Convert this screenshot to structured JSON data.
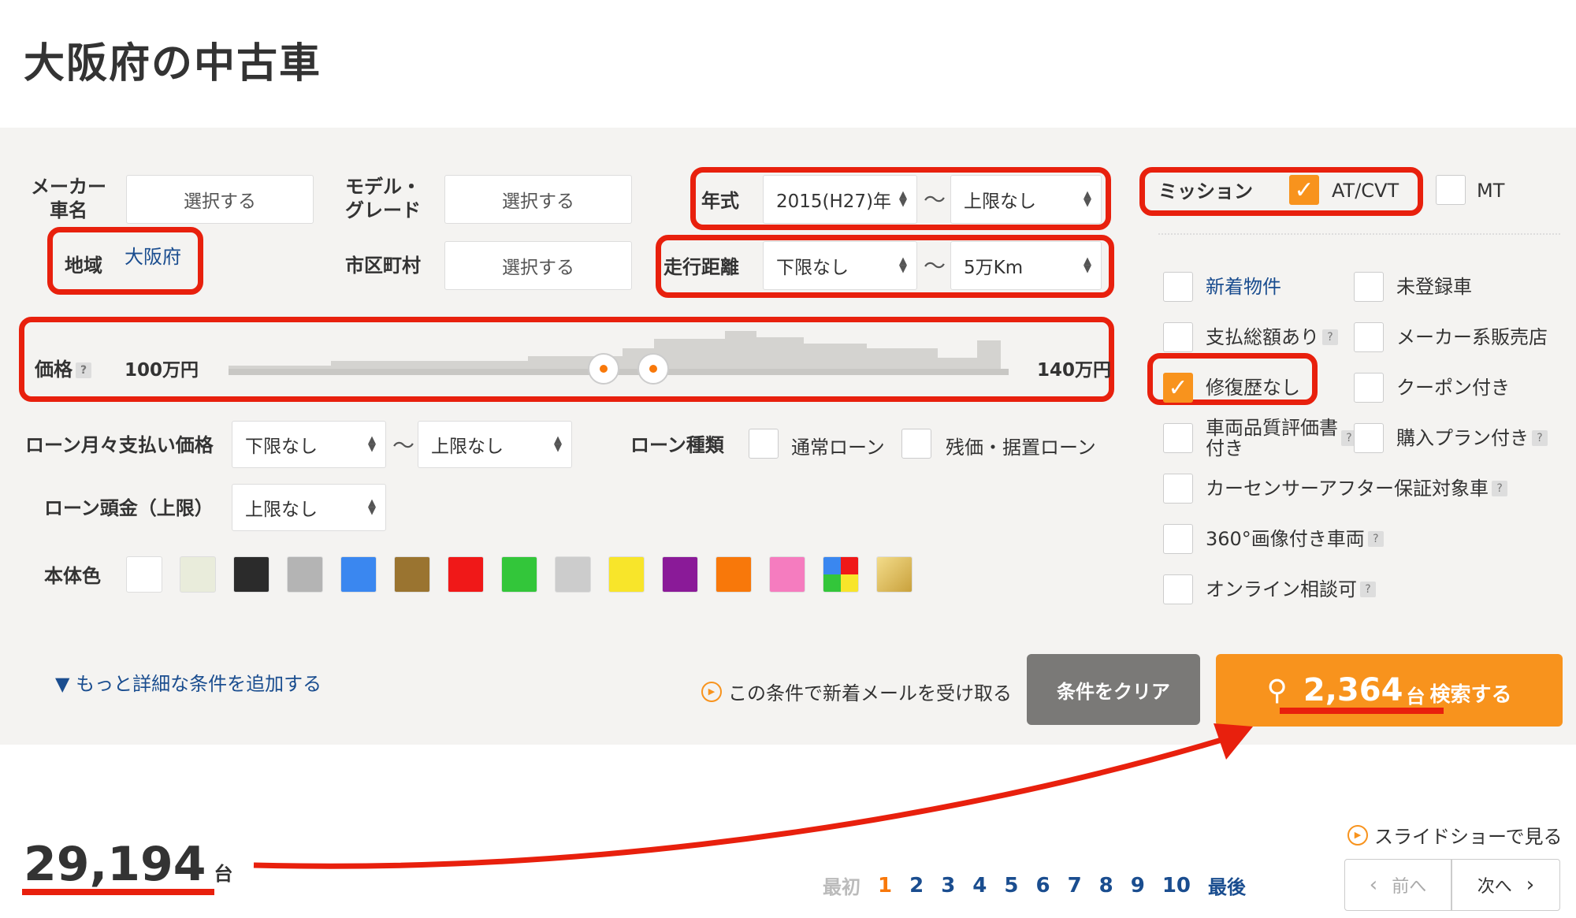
{
  "title": "大阪府の中古車",
  "filters": {
    "maker_label": "メーカー\n車名",
    "maker_btn": "選択する",
    "model_label": "モデル・\nグレード",
    "model_btn": "選択する",
    "region_label": "地域",
    "region_value": "大阪府",
    "city_label": "市区町村",
    "city_btn": "選択する",
    "year_label": "年式",
    "year_from": "2015(H27)年",
    "year_to": "上限なし",
    "mileage_label": "走行距離",
    "mileage_from": "下限なし",
    "mileage_to": "5万Km",
    "tilde": "〜",
    "price_label": "価格",
    "price_min": "100万円",
    "price_max": "140万円",
    "loan_monthly_label": "ローン月々支払い価格",
    "loan_monthly_from": "下限なし",
    "loan_monthly_to": "上限なし",
    "loan_type_label": "ローン種類",
    "loan_type_normal": "通常ローン",
    "loan_type_residual": "残価・据置ローン",
    "loan_down_label": "ローン頭金（上限）",
    "loan_down_value": "上限なし",
    "color_label": "本体色",
    "colors": [
      "#ffffff",
      "#e9ecdb",
      "#2b2b2b",
      "#b4b4b4",
      "#3a87f0",
      "#9a7430",
      "#f01818",
      "#33c63a",
      "#cccccc",
      "#f8e52a",
      "#8a1a98",
      "#f8780a",
      "#f57cbf",
      "multi",
      "gold"
    ],
    "mission_label": "ミッション",
    "mission_at": "AT/CVT",
    "mission_mt": "MT",
    "help": "?"
  },
  "options_left": [
    {
      "label": "新着物件",
      "checked": false,
      "link": true
    },
    {
      "label": "支払総額あり",
      "checked": false,
      "help": true
    },
    {
      "label": "修復歴なし",
      "checked": true
    },
    {
      "label": "車両品質評価書\n付き",
      "checked": false,
      "help": true
    },
    {
      "label": "カーセンサーアフター保証対象車",
      "checked": false,
      "help": true
    },
    {
      "label": "360°画像付き車両",
      "checked": false,
      "help": true
    },
    {
      "label": "オンライン相談可",
      "checked": false,
      "help": true
    }
  ],
  "options_right": [
    {
      "label": "未登録車",
      "checked": false
    },
    {
      "label": "メーカー系販売店",
      "checked": false
    },
    {
      "label": "クーポン付き",
      "checked": false
    },
    {
      "label": "購入プラン付き",
      "checked": false,
      "help": true
    }
  ],
  "actions": {
    "more_conditions": "▼ もっと詳細な条件を追加する",
    "mail_notice": "この条件で新着メールを受け取る",
    "clear": "条件をクリア",
    "search_count": "2,364",
    "search_unit": "台",
    "search_text": "検索する"
  },
  "results": {
    "total": "29,194",
    "unit": "台",
    "slideshow": "スライドショーで見る",
    "first": "最初",
    "pages": [
      "1",
      "2",
      "3",
      "4",
      "5",
      "6",
      "7",
      "8",
      "9",
      "10"
    ],
    "current_page": "1",
    "last": "最後",
    "prev": "前へ",
    "next": "次へ"
  },
  "accent": "#f8931d",
  "annotation_color": "#e8200d"
}
